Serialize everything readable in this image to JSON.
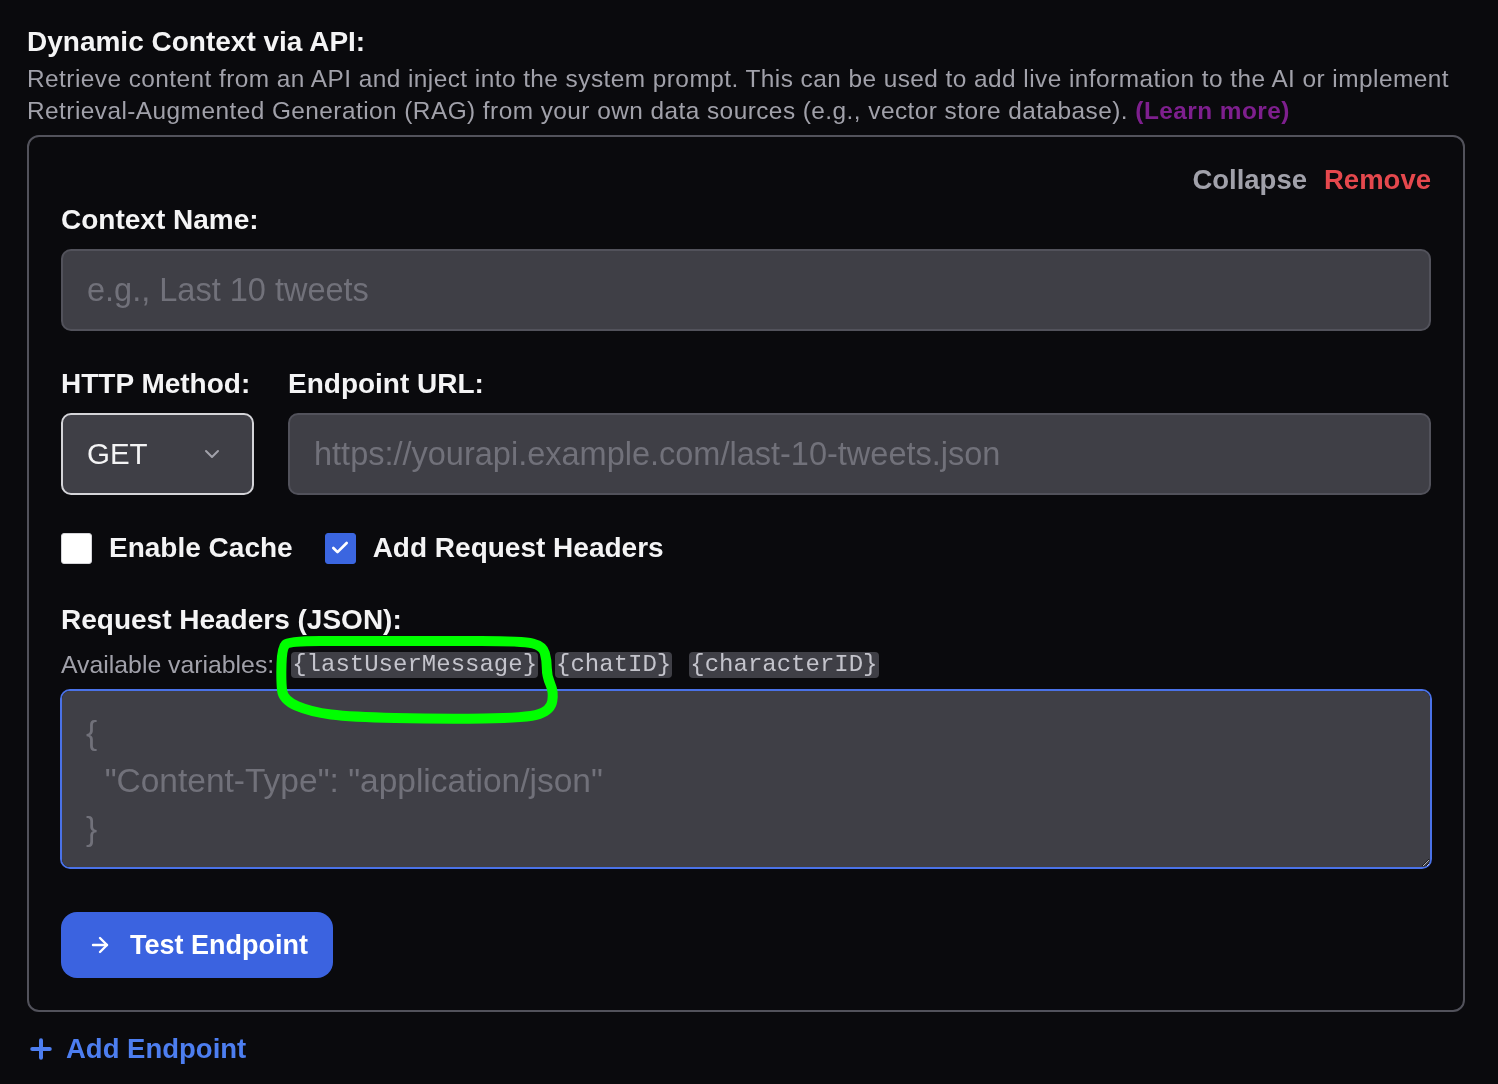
{
  "section": {
    "title": "Dynamic Context via API:",
    "description": "Retrieve content from an API and inject into the system prompt. This can be used to add live information to the AI or implement Retrieval-Augmented Generation (RAG) from your own data sources (e.g., vector store database).",
    "learn_more": "(Learn more)"
  },
  "endpoint_card": {
    "actions": [
      {
        "label": "Collapse",
        "kind": "neutral"
      },
      {
        "label": "Remove",
        "kind": "danger"
      }
    ],
    "context_name": {
      "label": "Context Name:",
      "placeholder": "e.g., Last 10 tweets"
    },
    "http_method": {
      "label": "HTTP Method:",
      "value": "GET"
    },
    "endpoint_url": {
      "label": "Endpoint URL:",
      "placeholder": "https://yourapi.example.com/last-10-tweets.json"
    },
    "options": [
      {
        "label": "Enable Cache",
        "checked": false
      },
      {
        "label": "Add Request Headers",
        "checked": true
      }
    ],
    "request_headers": {
      "label": "Request Headers (JSON):",
      "variables_label": "Available variables:",
      "variables": [
        {
          "text": "{lastUserMessage}",
          "circled": true
        },
        {
          "text": "{chatID}",
          "circled": false
        },
        {
          "text": "{characterID}",
          "circled": false
        }
      ],
      "placeholder": "{\n  \"Content-Type\": \"application/json\"\n}",
      "focused": true
    },
    "test_button": "Test Endpoint"
  },
  "add_endpoint": "Add Endpoint"
}
